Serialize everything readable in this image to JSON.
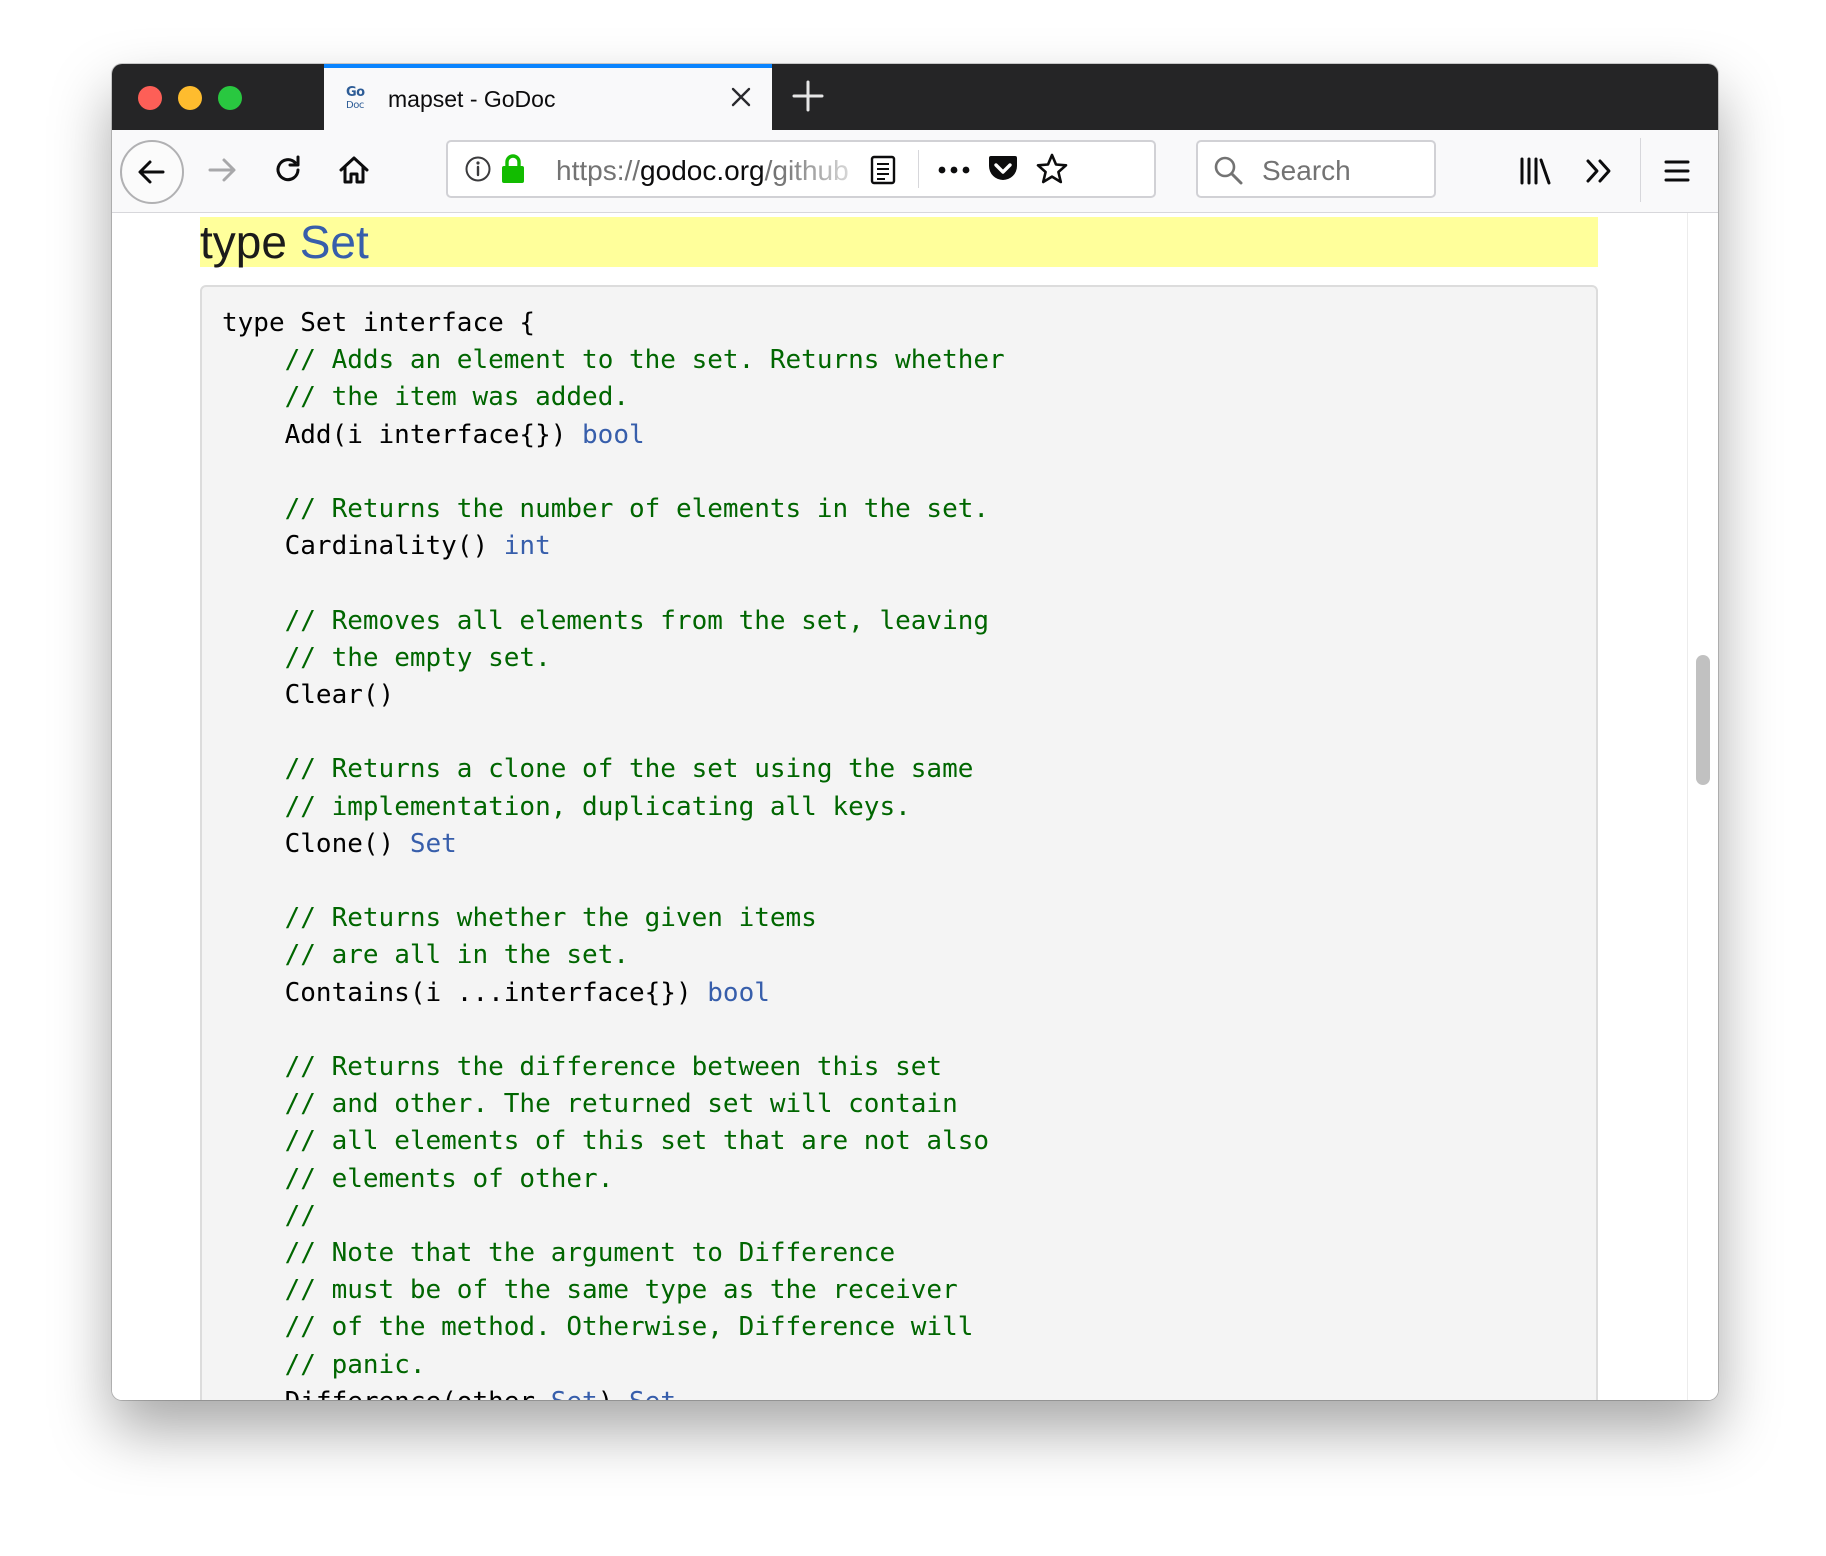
{
  "browser": {
    "tab": {
      "title": "mapset - GoDoc",
      "favicon_text_top": "Go",
      "favicon_text_bottom": "Doc"
    },
    "url": {
      "scheme": "https://",
      "host": "godoc.org",
      "path_fragment": "/github"
    },
    "search_placeholder": "Search"
  },
  "page": {
    "heading_keyword": "type",
    "heading_name": "Set"
  },
  "code": {
    "lines": [
      [
        {
          "t": "type Set interface {"
        }
      ],
      [
        {
          "t": "    "
        },
        {
          "t": "// Adds an element to the set. Returns whether",
          "c": "comment"
        }
      ],
      [
        {
          "t": "    "
        },
        {
          "t": "// the item was added.",
          "c": "comment"
        }
      ],
      [
        {
          "t": "    Add(i interface{}) "
        },
        {
          "t": "bool",
          "c": "type"
        }
      ],
      [
        {
          "t": ""
        }
      ],
      [
        {
          "t": "    "
        },
        {
          "t": "// Returns the number of elements in the set.",
          "c": "comment"
        }
      ],
      [
        {
          "t": "    Cardinality() "
        },
        {
          "t": "int",
          "c": "type"
        }
      ],
      [
        {
          "t": ""
        }
      ],
      [
        {
          "t": "    "
        },
        {
          "t": "// Removes all elements from the set, leaving",
          "c": "comment"
        }
      ],
      [
        {
          "t": "    "
        },
        {
          "t": "// the empty set.",
          "c": "comment"
        }
      ],
      [
        {
          "t": "    Clear()"
        }
      ],
      [
        {
          "t": ""
        }
      ],
      [
        {
          "t": "    "
        },
        {
          "t": "// Returns a clone of the set using the same",
          "c": "comment"
        }
      ],
      [
        {
          "t": "    "
        },
        {
          "t": "// implementation, duplicating all keys.",
          "c": "comment"
        }
      ],
      [
        {
          "t": "    Clone() "
        },
        {
          "t": "Set",
          "c": "type"
        }
      ],
      [
        {
          "t": ""
        }
      ],
      [
        {
          "t": "    "
        },
        {
          "t": "// Returns whether the given items",
          "c": "comment"
        }
      ],
      [
        {
          "t": "    "
        },
        {
          "t": "// are all in the set.",
          "c": "comment"
        }
      ],
      [
        {
          "t": "    Contains(i ...interface{}) "
        },
        {
          "t": "bool",
          "c": "type"
        }
      ],
      [
        {
          "t": ""
        }
      ],
      [
        {
          "t": "    "
        },
        {
          "t": "// Returns the difference between this set",
          "c": "comment"
        }
      ],
      [
        {
          "t": "    "
        },
        {
          "t": "// and other. The returned set will contain",
          "c": "comment"
        }
      ],
      [
        {
          "t": "    "
        },
        {
          "t": "// all elements of this set that are not also",
          "c": "comment"
        }
      ],
      [
        {
          "t": "    "
        },
        {
          "t": "// elements of other.",
          "c": "comment"
        }
      ],
      [
        {
          "t": "    "
        },
        {
          "t": "//",
          "c": "comment"
        }
      ],
      [
        {
          "t": "    "
        },
        {
          "t": "// Note that the argument to Difference",
          "c": "comment"
        }
      ],
      [
        {
          "t": "    "
        },
        {
          "t": "// must be of the same type as the receiver",
          "c": "comment"
        }
      ],
      [
        {
          "t": "    "
        },
        {
          "t": "// of the method. Otherwise, Difference will",
          "c": "comment"
        }
      ],
      [
        {
          "t": "    "
        },
        {
          "t": "// panic.",
          "c": "comment"
        }
      ],
      [
        {
          "t": "    Difference(other "
        },
        {
          "t": "Set",
          "c": "type"
        },
        {
          "t": ") "
        },
        {
          "t": "Set",
          "c": "type"
        }
      ]
    ]
  },
  "colors": {
    "comment": "#006600",
    "type_link": "#375eab",
    "heading_highlight": "#ffff9b",
    "tab_accent": "#0a84ff"
  },
  "icons": [
    "back-arrow-icon",
    "forward-arrow-icon",
    "reload-icon",
    "home-icon",
    "info-icon",
    "lock-icon",
    "reader-view-icon",
    "more-actions-icon",
    "pocket-icon",
    "bookmark-star-icon",
    "search-icon",
    "library-icon",
    "overflow-chevrons-icon",
    "hamburger-menu-icon",
    "close-icon",
    "plus-icon"
  ]
}
